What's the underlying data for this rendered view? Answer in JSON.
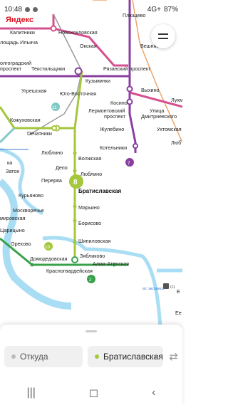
{
  "status_bar": {
    "time": "10:48",
    "battery": "87%",
    "network": "4G+"
  },
  "app": {
    "logo": "Яндекс"
  },
  "map": {
    "colors": {
      "purple": "#8a3fa0",
      "pink": "#d6508f",
      "lime": "#a4c73c",
      "green": "#38a14a",
      "orange": "#f0a56a",
      "lightblue": "#a9ddf4",
      "blue": "#3a7ad0",
      "gray": "#9a9a9a"
    },
    "stations": {
      "kalitniki": "Калитники",
      "novokhokhlovskaya": "Новохохловская",
      "ploshchad_ilicha": "лощадь Ильича",
      "okskaya": "Окская",
      "veshnyaki": "Вешняки",
      "volgogradsky": "олгоградский",
      "prospekt": "проспект",
      "tekstilshchiki": "Текстильщики",
      "ryazansky": "Рязанский проспект",
      "kuzminki": "Кузьминки",
      "ugreshskaya": "Угрешская",
      "yugo_vostochnaya": "Юго-Восточная",
      "vykhino": "Выхино",
      "kosino": "Косино",
      "lermontovsky": "Лермонтовский",
      "lermontovsky2": "проспект",
      "ulitsa": "Улица",
      "dmitrievskogo": "Дмитриевского",
      "lukh": "Лухм",
      "kozhukhovskaya": "Кожуховская",
      "pechatniki": "Печатники",
      "zhulebino": "Жулебино",
      "ukhtomskaya": "Ухтомская",
      "kotelniki": "Котельники",
      "lyubertsy": "Люб",
      "volzhskaya": "Волжская",
      "lyublino": "Люблино",
      "depo": "Депо",
      "lyublino2": "Люблино",
      "ka": "ка",
      "zaton": "Затон",
      "perervа": "Перерва",
      "bratislavskaya": "Братиславская",
      "kuryanovo": "Курьяново",
      "maryino": "Марьино",
      "moskvorechye": "Москворечье",
      "mirovskaya": "мировская",
      "borisovo": "Борисово",
      "tsaritsyno": "Царицыно",
      "shipilovskaya": "Шипиловская",
      "orekhovo": "Орехово",
      "domodedovskaya": "Домодедовская",
      "zyablikovo": "Зябликово",
      "alma_atinskaya": "Алма-Атинская",
      "krasnogvardeyskaya": "Красногвардейская",
      "ploshchevo": "Плющево",
      "ee": "Ее",
      "e": "Е"
    },
    "badges": {
      "line8": "8",
      "line11": "11",
      "line7": "7",
      "line10": "10",
      "line2": "2",
      "d1": "D1",
      "ekspress": "ат. экспресс",
      "mcd": "ект"
    }
  },
  "sheet": {
    "from_placeholder": "Откуда",
    "to_value": "Братиславская",
    "clear_label": "×",
    "swap_label": "⇄"
  },
  "navbar": {
    "recent": "|||",
    "home": "◻",
    "back": "‹"
  }
}
